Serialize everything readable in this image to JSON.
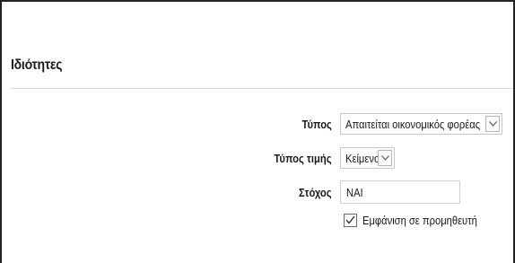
{
  "panel": {
    "title": "Ιδιότητες"
  },
  "fields": {
    "type": {
      "label": "Τύπος",
      "value": "Απαιτείται οικονομικός φορέας"
    },
    "value_type": {
      "label": "Τύπος τιμής",
      "value": "Κείμενο"
    },
    "target": {
      "label": "Στόχος",
      "value": "ΝΑΙ"
    },
    "show_to_supplier": {
      "label": "Εμφάνιση σε προμηθευτή",
      "checked": true
    }
  },
  "icons": {
    "dropdown": "chevron-down-icon",
    "check": "checkmark-icon"
  }
}
